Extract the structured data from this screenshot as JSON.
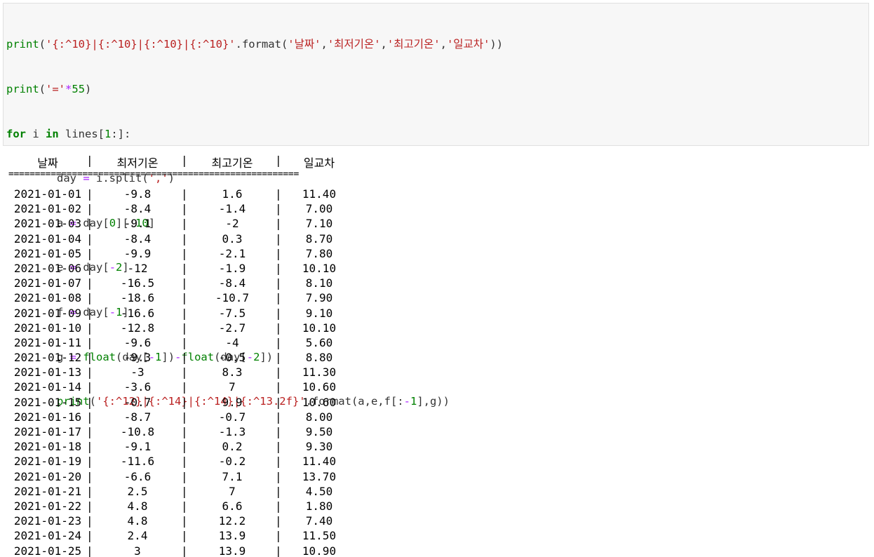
{
  "code_cell": {
    "line1": {
      "fn": "print",
      "p1": "(",
      "str": "'{:^10}|{:^10}|{:^10}|{:^10}'",
      "method": ".format(",
      "a1": "'날짜'",
      "a2": "'최저기온'",
      "a3": "'최고기온'",
      "a4": "'일교차'",
      "comma": ",",
      "close": "))"
    },
    "line2": {
      "fn": "print",
      "p1": "(",
      "str": "'='",
      "op": "*",
      "num": "55",
      "close": ")"
    },
    "line3": {
      "kw_for": "for",
      "var": " i ",
      "kw_in": "in",
      "rest": " lines[",
      "num": "1",
      "rest2": ":]:"
    },
    "line4": {
      "var": "day ",
      "op": "=",
      "rest": " i.split(",
      "str": "','",
      "close": ")"
    },
    "line5": {
      "var": "a ",
      "op": "=",
      "rest": " day[",
      "num1": "0",
      "mid": "][:",
      "num2": "10",
      "close": "]"
    },
    "line6": {
      "var": "e ",
      "op": "=",
      "rest": " day[",
      "op2": "-",
      "num": "2",
      "close": "]"
    },
    "line7": {
      "var": "f ",
      "op": "=",
      "rest": " day[",
      "op2": "-",
      "num": "1",
      "close": "]"
    },
    "line8": {
      "var": "g ",
      "op": "=",
      "sp": " ",
      "fn1": "float",
      "p1": "(day[",
      "op2": "-",
      "num1": "1",
      "mid": "])",
      "op3": "-",
      "fn2": "float",
      "p2": "(day[",
      "op4": "-",
      "num2": "2",
      "close": "])"
    },
    "line9": {
      "fn": "print",
      "p1": "(",
      "str": "'{:^12}|{:^14}|{:^14}|{:^13.2f}'",
      "rest": ".format(a,e,f[:",
      "op": "-",
      "num": "1",
      "close": "],g))"
    }
  },
  "output": {
    "headers": [
      "날짜",
      "최저기온",
      "최고기온",
      "일교차"
    ],
    "separator": "=======================================================",
    "bar": "|",
    "rows": [
      [
        "2021-01-01",
        "-9.8",
        "1.6",
        "11.40"
      ],
      [
        "2021-01-02",
        "-8.4",
        "-1.4",
        "7.00"
      ],
      [
        "2021-01-03",
        "-9.1",
        "-2",
        "7.10"
      ],
      [
        "2021-01-04",
        "-8.4",
        "0.3",
        "8.70"
      ],
      [
        "2021-01-05",
        "-9.9",
        "-2.1",
        "7.80"
      ],
      [
        "2021-01-06",
        "-12",
        "-1.9",
        "10.10"
      ],
      [
        "2021-01-07",
        "-16.5",
        "-8.4",
        "8.10"
      ],
      [
        "2021-01-08",
        "-18.6",
        "-10.7",
        "7.90"
      ],
      [
        "2021-01-09",
        "-16.6",
        "-7.5",
        "9.10"
      ],
      [
        "2021-01-10",
        "-12.8",
        "-2.7",
        "10.10"
      ],
      [
        "2021-01-11",
        "-9.6",
        "-4",
        "5.60"
      ],
      [
        "2021-01-12",
        "-9.3",
        "-0.5",
        "8.80"
      ],
      [
        "2021-01-13",
        "-3",
        "8.3",
        "11.30"
      ],
      [
        "2021-01-14",
        "-3.6",
        "7",
        "10.60"
      ],
      [
        "2021-01-15",
        "-0.7",
        "9.9",
        "10.60"
      ],
      [
        "2021-01-16",
        "-8.7",
        "-0.7",
        "8.00"
      ],
      [
        "2021-01-17",
        "-10.8",
        "-1.3",
        "9.50"
      ],
      [
        "2021-01-18",
        "-9.1",
        "0.2",
        "9.30"
      ],
      [
        "2021-01-19",
        "-11.6",
        "-0.2",
        "11.40"
      ],
      [
        "2021-01-20",
        "-6.6",
        "7.1",
        "13.70"
      ],
      [
        "2021-01-21",
        "2.5",
        "7",
        "4.50"
      ],
      [
        "2021-01-22",
        "4.8",
        "6.6",
        "1.80"
      ],
      [
        "2021-01-23",
        "4.8",
        "12.2",
        "7.40"
      ],
      [
        "2021-01-24",
        "2.4",
        "13.9",
        "11.50"
      ],
      [
        "2021-01-25",
        "3",
        "13.9",
        "10.90"
      ]
    ]
  }
}
